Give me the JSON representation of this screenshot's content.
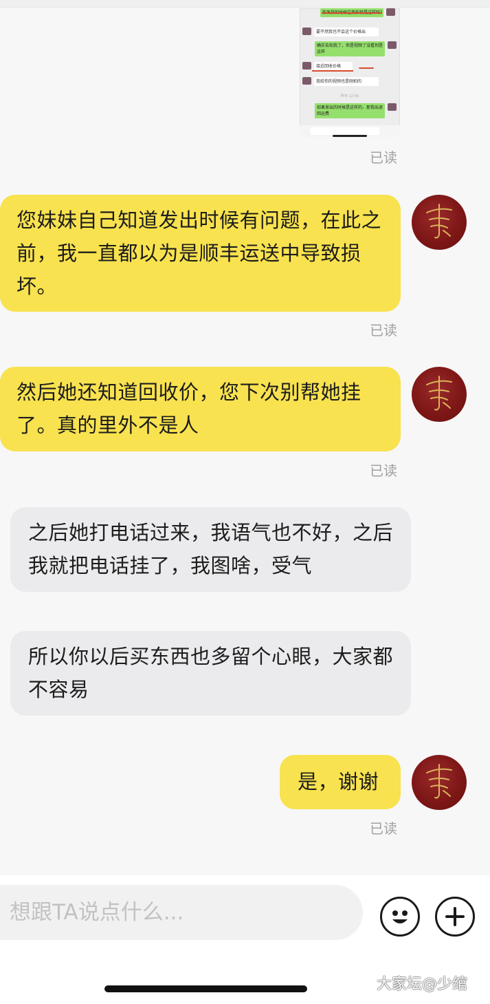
{
  "image_message": {
    "bubbles": [
      {
        "side": "right",
        "text": "你发货的时候它变形就是这样吗？如果是的话，我出运费"
      },
      {
        "side": "left",
        "text": "要不然我也不会这个价格出"
      },
      {
        "side": "right",
        "text": "确实告知我了，但是视频了没看到是这样"
      },
      {
        "side": "left",
        "text": "接近回收价格"
      },
      {
        "side": "left",
        "text": "我给你的视频也是刚拍的"
      },
      {
        "side": "right",
        "text": "如果发出的时候是这样的，那我出退回运费"
      }
    ],
    "timestamp": "昨天 12:56"
  },
  "messages": [
    {
      "side": "mine",
      "text": "您妹妹自己知道发出时候有问题，在此之前，我一直都以为是顺丰运送中导致损坏。",
      "status": "已读"
    },
    {
      "side": "mine",
      "text": "然后她还知道回收价，您下次别帮她挂了。真的里外不是人",
      "status": "已读"
    },
    {
      "side": "theirs",
      "text": "之后她打电话过来，我语气也不好，之后我就把电话挂了，我图啥，受气"
    },
    {
      "side": "theirs",
      "text": "所以你以后买东西也多留个心眼，大家都不容易"
    },
    {
      "side": "mine",
      "text": "是，谢谢",
      "status": "已读"
    }
  ],
  "first_status": "已读",
  "composer": {
    "placeholder": "想跟TA说点什么...",
    "emoji_icon": "smiley-face-icon",
    "plus_icon": "plus-circle-icon"
  },
  "watermark": "大家坛@少绾",
  "colors": {
    "my_bubble": "#f8e24f",
    "their_bubble": "#ebebed",
    "avatar_red": "#7e1717",
    "gold": "#d9b55a"
  }
}
